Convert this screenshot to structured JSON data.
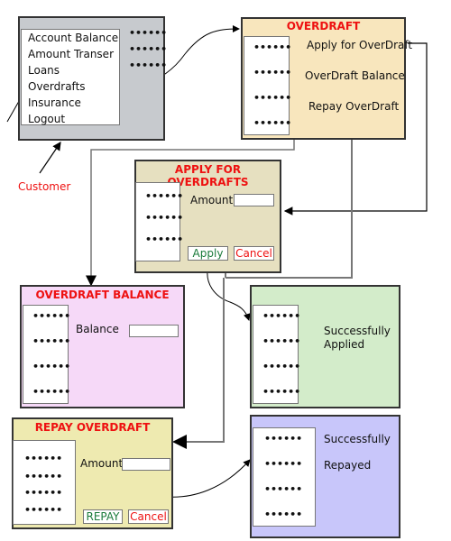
{
  "main_menu": {
    "items": [
      "Account Balance",
      "Amount Transer",
      "Loans",
      "Overdrafts",
      "Insurance",
      "Logout"
    ],
    "dots": [
      "••••••",
      "••••••",
      "••••••"
    ],
    "bg_color": "#c7cace"
  },
  "actor": {
    "label": "Customer"
  },
  "overdraft": {
    "title": "OVERDRAFT",
    "options": [
      "Apply for OverDraft",
      "OverDraft Balance",
      "Repay OverDraft"
    ],
    "side_dots": [
      "••••••",
      "••••••",
      "••••••",
      "••••••"
    ],
    "bg_color": "#f8e6bd"
  },
  "apply": {
    "title": "APPLY FOR OVERDRAFTS",
    "amount_label": "Amount",
    "amount_value": "",
    "apply_label": "Apply",
    "cancel_label": "Cancel",
    "side_dots": [
      "••••••",
      "••••••",
      "••••••"
    ],
    "bg_color": "#e6e0c0"
  },
  "balance": {
    "title": "OVERDRAFT BALANCE",
    "balance_label": "Balance",
    "balance_value": "",
    "side_dots": [
      "••••••",
      "••••••",
      "••••••",
      "••••••"
    ],
    "bg_color": "#f6d9f8"
  },
  "applied": {
    "message_line1": "Successfully",
    "message_line2": "Applied",
    "side_dots": [
      "••••••",
      "••••••",
      "••••••",
      "••••••"
    ],
    "bg_color": "#d3ecca"
  },
  "repay": {
    "title": "REPAY OVERDRAFT",
    "amount_label": "Amount",
    "amount_value": "",
    "repay_label": "REPAY",
    "cancel_label": "Cancel",
    "side_dots": [
      "••••••",
      "••••••",
      "••••••",
      "••••••"
    ],
    "bg_color": "#eeeab0"
  },
  "repaid": {
    "message_line1": "Successfully",
    "message_line2": "Repayed",
    "side_dots": [
      "••••••",
      "••••••",
      "••••••",
      "••••••"
    ],
    "bg_color": "#c8c6fa"
  }
}
